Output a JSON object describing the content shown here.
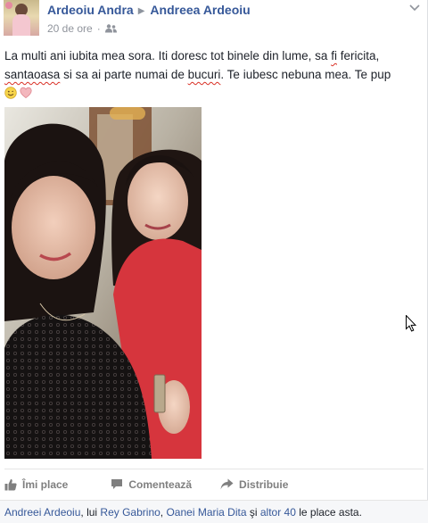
{
  "post": {
    "author": "Ardeoiu Andra",
    "target": "Andreea Ardeoiu",
    "arrow": "▶",
    "time": "20 de ore",
    "separator": "·",
    "audience_icon": "friends-icon",
    "menu_icon": "chevron-down-icon",
    "text": {
      "p1": "La multi ani iubita mea sora. Iti doresc tot binele din lume, sa ",
      "w1": "fi",
      "p2": " fericita, ",
      "w2": "santaoasa",
      "p3": " si sa ai parte numai de ",
      "w3": "bucuri",
      "p4": ". Te iubesc nebuna mea. Te pup"
    },
    "emojis": [
      "smile-emoji",
      "heart-emoji"
    ],
    "photo_alt": "two-sisters-selfie"
  },
  "actions": {
    "like": "Îmi place",
    "comment": "Comentează",
    "share": "Distribuie"
  },
  "likes_bar": {
    "name1": "Andreei Ardeoiu",
    "sep1": ", lui ",
    "name2": "Rey Gabrino",
    "sep2": ", ",
    "name3": "Oanei Maria Dita",
    "sep3": " şi ",
    "others": "altor 40",
    "suffix": " le place asta."
  },
  "colors": {
    "link": "#365899",
    "misspell": "#d93025",
    "muted": "#90949c"
  }
}
